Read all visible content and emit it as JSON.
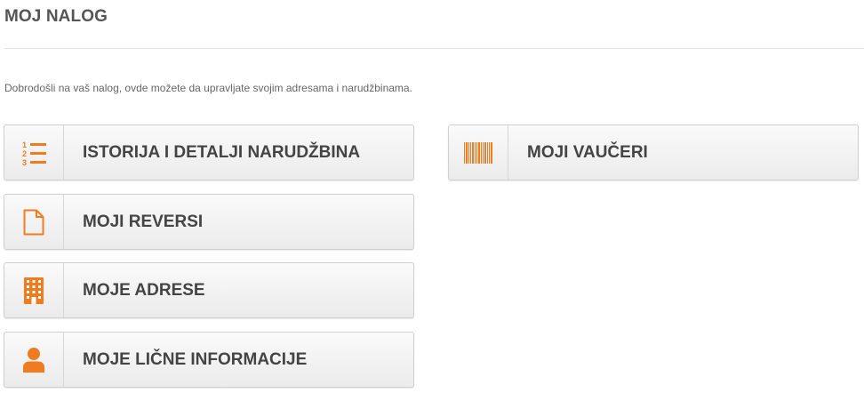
{
  "header": {
    "title": "MOJ NALOG"
  },
  "welcome_text": "Dobrodošli na vaš nalog, ovde možete da upravljate svojim adresama i narudžbinama.",
  "tiles": [
    {
      "label": "ISTORIJA I DETALJI NARUDŽBINA",
      "icon": "numbered-list-icon"
    },
    {
      "label": "MOJI VAUČERI",
      "icon": "barcode-icon"
    },
    {
      "label": "MOJI REVERSI",
      "icon": "document-icon"
    },
    {
      "label": "MOJE ADRESE",
      "icon": "building-icon"
    },
    {
      "label": "MOJE LIČNE INFORMACIJE",
      "icon": "user-icon"
    }
  ],
  "colors": {
    "accent": "#f07c22",
    "title": "#555555",
    "tile_text": "#444444"
  }
}
